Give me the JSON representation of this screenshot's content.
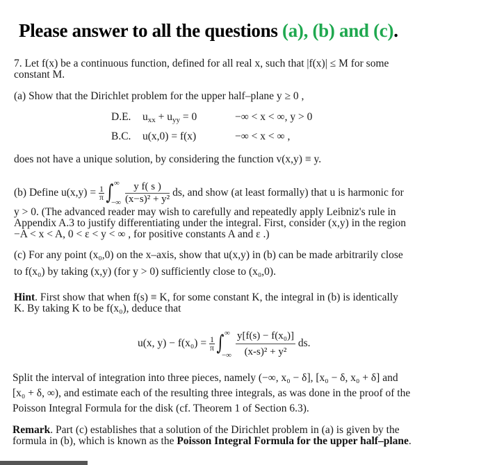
{
  "title": {
    "prefix": "Please answer to all the questions ",
    "highlight": "(a), (b) and (c)",
    "suffix": ".",
    "highlight_color": "#1fa84f"
  },
  "problem": {
    "line1": "7.  Let  f(x)  be a continuous function, defined for all real  x,  such that  |f(x)| ≤ M  for some",
    "line2": "constant  M.",
    "part_a_intro": "(a)  Show that the Dirichlet problem for the upper half–plane  y ≥ 0 ,",
    "de_label": "D.E.",
    "de_eq_u": "u",
    "de_sub1": "xx",
    "de_plus": " + u",
    "de_sub2": "yy",
    "de_rest": " = 0",
    "de_domain": "−∞ < x < ∞, y > 0",
    "bc_label": "B.C.",
    "bc_eq": "u(x,0) = f(x)",
    "bc_domain": "−∞ < x < ∞ ,",
    "part_a_end": "does not have a unique solution, by considering the function  v(x,y) ≡ y.",
    "part_b_start": "(b)  Define  u(x,y) = ",
    "part_b_frac_num": "1",
    "part_b_frac_den": "π",
    "int_upper": "∞",
    "int_lower": "−∞",
    "part_b_integrand_num": "y  f( s )",
    "part_b_integrand_den": "(x−s)² + y²",
    "part_b_after": " ds,  and show (at least formally) that  u  is harmonic for",
    "part_b_line2": "y > 0.   (The advanced reader may wish to carefully and repeatedly apply Leibniz's rule in",
    "part_b_line3": "Appendix A.3 to justify differentiating under the integral.  First, consider  (x,y)  in the region",
    "part_b_line4": "−A < x < A,  0 < ε < y < ∞ ,  for positive constants  A  and  ε .)",
    "part_c_line1": "(c)  For any point  (x₀,0)  on the x–axis, show that  u(x,y)  in  (b)  can be made arbitrarily close",
    "part_c_line2": "to  f(x₀)  by taking  (x,y)  (for  y > 0)  sufficiently close to  (x₀,0).",
    "hint_label": "Hint",
    "hint_line1": ".  First show that when  f(s) ≡ K,  for some constant  K,  the integral in  (b)  is identically",
    "hint_line2": "K.  By taking  K  to be  f(x₀),  deduce that",
    "hint_eq_lhs": "u(x, y) − f(x₀) = ",
    "hint_eq_num": "y[f(s)  −  f(x₀)]",
    "hint_eq_den": "(x-s)²  + y²",
    "hint_eq_after": " ds.",
    "split_line1": "Split the interval of integration into three pieces, namely  (−∞, x₀ − δ],  [x₀ − δ, x₀ + δ]  and",
    "split_line2": "[x₀ + δ, ∞),  and estimate each of the resulting three integrals, as was done in the proof of the",
    "split_line3": "Poisson Integral Formula for the disk (cf. Theorem 1 of Section 6.3).",
    "remark_label": "Remark",
    "remark_line1": ".  Part  (c)  establishes that a solution of the Dirichlet problem in  (a)  is given by the",
    "remark_line2_start": "formula in  (b), which is known as the ",
    "remark_bold": "Poisson Integral Formula for the upper half–plane",
    "remark_end": "."
  }
}
